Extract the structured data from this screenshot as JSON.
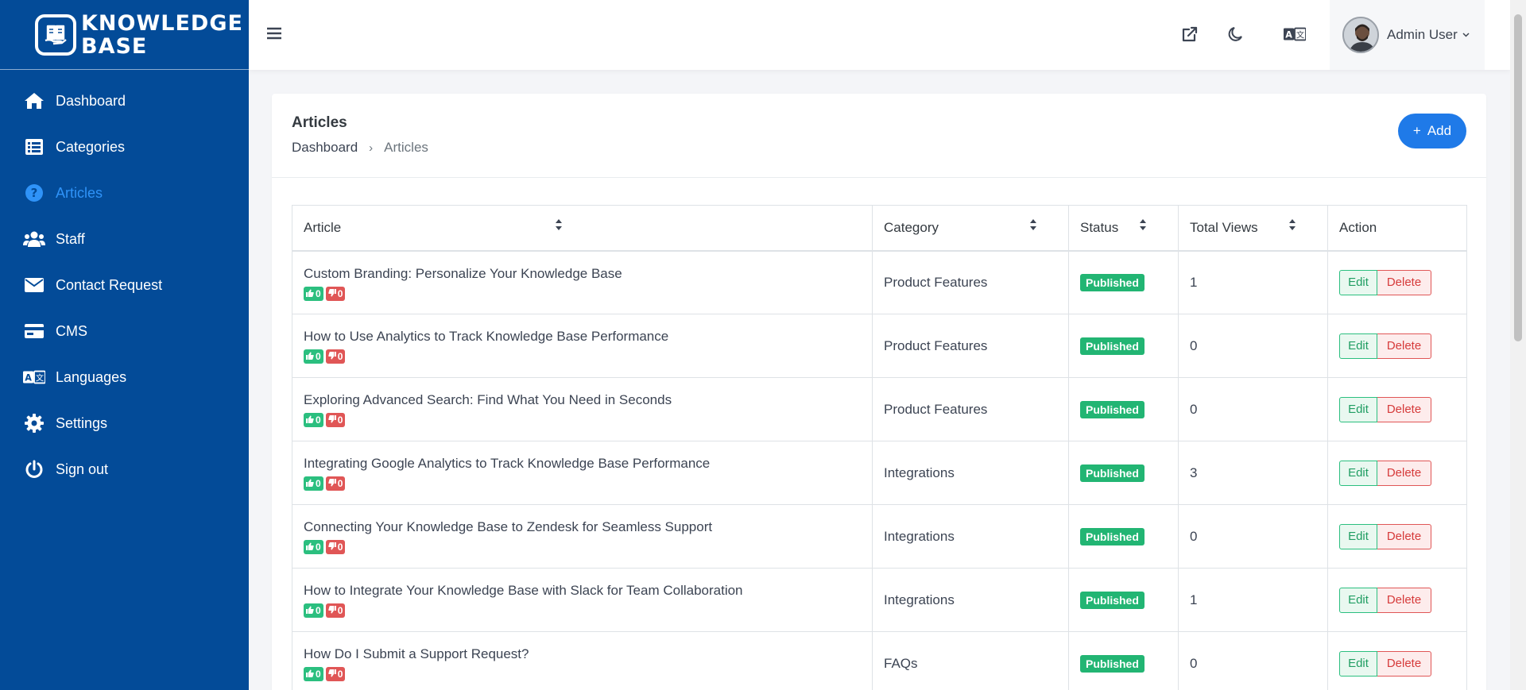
{
  "brand": {
    "line1": "KNOWLEDGE",
    "line2": "BASE"
  },
  "sidebar": {
    "items": [
      {
        "label": "Dashboard",
        "icon": "home-icon",
        "active": false
      },
      {
        "label": "Categories",
        "icon": "list-icon",
        "active": false
      },
      {
        "label": "Articles",
        "icon": "question-circle-icon",
        "active": true
      },
      {
        "label": "Staff",
        "icon": "users-icon",
        "active": false
      },
      {
        "label": "Contact Request",
        "icon": "envelope-icon",
        "active": false
      },
      {
        "label": "CMS",
        "icon": "card-icon",
        "active": false
      },
      {
        "label": "Languages",
        "icon": "translate-icon",
        "active": false
      },
      {
        "label": "Settings",
        "icon": "gear-icon",
        "active": false
      },
      {
        "label": "Sign out",
        "icon": "power-icon",
        "active": false
      }
    ]
  },
  "topbar": {
    "user_name": "Admin User"
  },
  "page": {
    "title": "Articles",
    "breadcrumb": {
      "home": "Dashboard",
      "separator": "›",
      "current": "Articles"
    },
    "add_label": "Add",
    "add_icon": "+"
  },
  "table": {
    "headers": {
      "article": "Article",
      "category": "Category",
      "status": "Status",
      "views": "Total Views",
      "action": "Action"
    },
    "edit_label": "Edit",
    "delete_label": "Delete",
    "rows": [
      {
        "title": "Custom Branding: Personalize Your Knowledge Base",
        "likes": "0",
        "dislikes": "0",
        "category": "Product Features",
        "status": "Published",
        "views": "1"
      },
      {
        "title": "How to Use Analytics to Track Knowledge Base Performance",
        "likes": "0",
        "dislikes": "0",
        "category": "Product Features",
        "status": "Published",
        "views": "0"
      },
      {
        "title": "Exploring Advanced Search: Find What You Need in Seconds",
        "likes": "0",
        "dislikes": "0",
        "category": "Product Features",
        "status": "Published",
        "views": "0"
      },
      {
        "title": "Integrating Google Analytics to Track Knowledge Base Performance",
        "likes": "0",
        "dislikes": "0",
        "category": "Integrations",
        "status": "Published",
        "views": "3"
      },
      {
        "title": "Connecting Your Knowledge Base to Zendesk for Seamless Support",
        "likes": "0",
        "dislikes": "0",
        "category": "Integrations",
        "status": "Published",
        "views": "0"
      },
      {
        "title": "How to Integrate Your Knowledge Base with Slack for Team Collaboration",
        "likes": "0",
        "dislikes": "0",
        "category": "Integrations",
        "status": "Published",
        "views": "1"
      },
      {
        "title": "How Do I Submit a Support Request?",
        "likes": "0",
        "dislikes": "0",
        "category": "FAQs",
        "status": "Published",
        "views": "0"
      }
    ]
  },
  "colors": {
    "sidebar": "#034b98",
    "active": "#2f93f8",
    "primary": "#1f7ae8",
    "success": "#22b573",
    "danger": "#e05656"
  }
}
